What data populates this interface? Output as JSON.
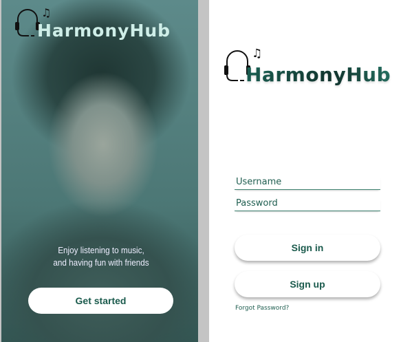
{
  "hero": {
    "brand": "HarmonyHub",
    "tagline_line1": "Enjoy listening to music,",
    "tagline_line2": "and having fun with friends",
    "get_started": "Get started"
  },
  "login": {
    "brand": "HarmonyHub",
    "username_placeholder": "Username",
    "password_placeholder": "Password",
    "sign_in": "Sign in",
    "sign_up": "Sign up",
    "forgot": "Forgot Password?"
  },
  "colors": {
    "accent": "#1a5a4c",
    "divider": "#c4c4c4"
  }
}
